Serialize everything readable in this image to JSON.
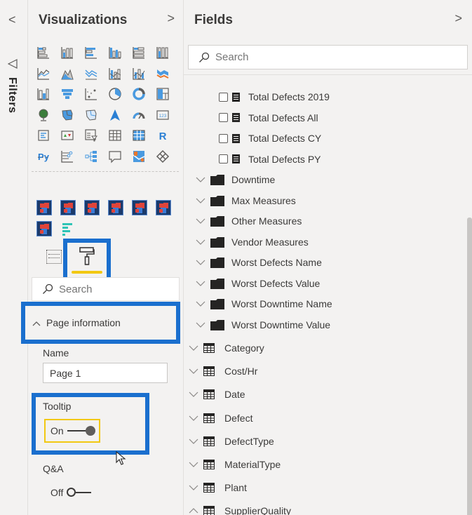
{
  "filters_strip": {
    "collapse_glyph": "<",
    "icon": "filter-icon",
    "label": "Filters"
  },
  "visualizations": {
    "title": "Visualizations",
    "expand_glyph": ">",
    "visual_types": [
      "stacked-bar-chart",
      "stacked-column-chart",
      "clustered-bar-chart",
      "clustered-column-chart",
      "100-stacked-bar-chart",
      "100-stacked-column-chart",
      "line-chart",
      "area-chart",
      "stacked-area-chart",
      "line-and-stacked-column-chart",
      "line-and-clustered-column-chart",
      "ribbon-chart",
      "waterfall-chart",
      "funnel-chart",
      "scatter-chart",
      "pie-chart",
      "donut-chart",
      "treemap",
      "map",
      "filled-map",
      "shape-map",
      "azure-map",
      "gauge",
      "card",
      "multi-row-card",
      "kpi",
      "slicer",
      "table",
      "matrix",
      "r-script-visual",
      "python-visual",
      "key-influencers",
      "decomposition-tree",
      "qa-visual",
      "arcgis-map",
      "power-apps"
    ],
    "r_label": "R",
    "py_label": "Py",
    "card_label": "123",
    "more_label": "...",
    "custom_visuals": [
      "custom-visual",
      "custom-visual",
      "custom-visual",
      "custom-visual",
      "custom-visual",
      "custom-visual",
      "custom-visual",
      "custom-bar-visual"
    ],
    "tabs": {
      "fields_tab": "fields-tab",
      "format_tab": "format-tab",
      "active": "format"
    },
    "search": {
      "placeholder": "Search"
    },
    "page_information": {
      "chevron": "^",
      "label": "Page information",
      "expanded": true,
      "name_label": "Name",
      "name_value": "Page 1",
      "tooltip_label": "Tooltip",
      "tooltip_state": "On",
      "qa_label": "Q&A",
      "qa_state": "Off"
    }
  },
  "fields": {
    "title": "Fields",
    "expand_glyph": ">",
    "search": {
      "placeholder": "Search"
    },
    "measures": [
      {
        "label": "Total Defects 2019",
        "checked": false
      },
      {
        "label": "Total Defects All",
        "checked": false
      },
      {
        "label": "Total Defects CY",
        "checked": false
      },
      {
        "label": "Total Defects PY",
        "checked": false
      }
    ],
    "folders": [
      {
        "label": "Downtime"
      },
      {
        "label": "Max Measures"
      },
      {
        "label": "Other Measures"
      },
      {
        "label": "Vendor Measures"
      },
      {
        "label": "Worst Defects Name"
      },
      {
        "label": "Worst Defects Value"
      },
      {
        "label": "Worst Downtime Name"
      },
      {
        "label": "Worst Downtime Value"
      }
    ],
    "tables": [
      {
        "label": "Category",
        "expanded": false
      },
      {
        "label": "Cost/Hr",
        "expanded": false
      },
      {
        "label": "Date",
        "expanded": false
      },
      {
        "label": "Defect",
        "expanded": false
      },
      {
        "label": "DefectType",
        "expanded": false
      },
      {
        "label": "MaterialType",
        "expanded": false
      },
      {
        "label": "Plant",
        "expanded": false
      },
      {
        "label": "SupplierQuality",
        "expanded": true
      }
    ]
  },
  "colors": {
    "highlight_blue": "#1a6fce",
    "active_tab_yellow": "#f2c811",
    "pane_bg": "#f3f2f1",
    "visual_blue": "#4a9ae0"
  }
}
